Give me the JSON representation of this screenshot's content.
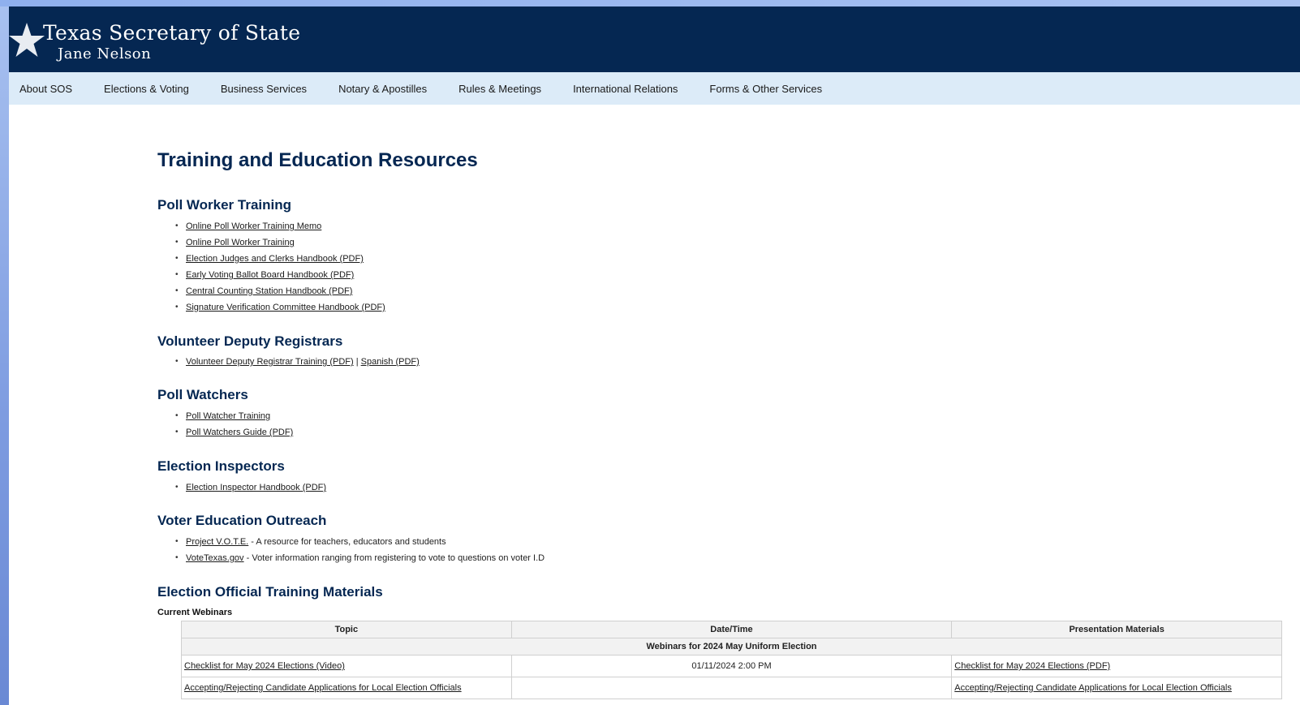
{
  "site": {
    "title": "Texas Secretary of State",
    "subtitle": "Jane Nelson"
  },
  "nav": [
    "About SOS",
    "Elections & Voting",
    "Business Services",
    "Notary & Apostilles",
    "Rules & Meetings",
    "International Relations",
    "Forms & Other Services"
  ],
  "page_title": "Training and Education Resources",
  "sections": {
    "poll_worker": {
      "heading": "Poll Worker Training",
      "links": [
        "Online Poll Worker Training Memo",
        "Online Poll Worker Training",
        "Election Judges and Clerks Handbook (PDF)",
        "Early Voting Ballot Board Handbook (PDF)",
        "Central Counting Station Handbook (PDF)",
        "Signature Verification Committee Handbook (PDF)"
      ]
    },
    "vdr": {
      "heading": "Volunteer Deputy Registrars",
      "link1": "Volunteer Deputy Registrar Training (PDF)",
      "separator": "|",
      "link2": "Spanish (PDF)"
    },
    "watchers": {
      "heading": "Poll Watchers",
      "links": [
        "Poll Watcher Training",
        "Poll Watchers Guide (PDF)"
      ]
    },
    "inspectors": {
      "heading": "Election Inspectors",
      "links": [
        "Election Inspector Handbook (PDF)"
      ]
    },
    "outreach": {
      "heading": "Voter Education Outreach",
      "items": [
        {
          "link": "Project V.O.T.E.",
          "text": " - A resource for teachers, educators and students"
        },
        {
          "link": "VoteTexas.gov",
          "text": " - Voter information ranging from registering to vote to questions on voter I.D"
        }
      ]
    },
    "materials": {
      "heading": "Election Official Training Materials",
      "label": "Current Webinars",
      "columns": [
        "Topic",
        "Date/Time",
        "Presentation Materials"
      ],
      "group": "Webinars for 2024 May Uniform Election",
      "rows": [
        {
          "topic": "Checklist for May 2024 Elections  (Video)",
          "datetime": "01/11/2024 2:00 PM",
          "materials": "Checklist for May 2024 Elections  (PDF)"
        },
        {
          "topic": "Accepting/Rejecting Candidate Applications for Local Election Officials",
          "datetime": "",
          "materials": "Accepting/Rejecting Candidate Applications for Local Election Officials"
        }
      ]
    }
  }
}
